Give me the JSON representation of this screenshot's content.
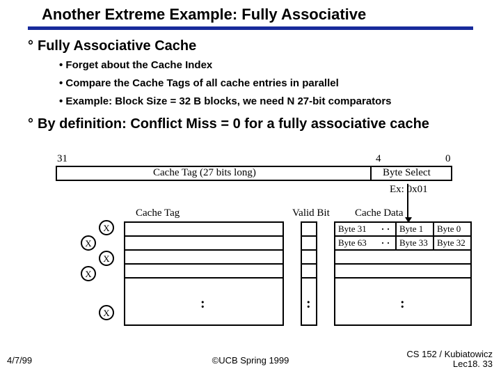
{
  "title": "Another Extreme Example: Fully Associative",
  "bullets": {
    "b1": "Fully Associative Cache",
    "s1": "Forget about the Cache Index",
    "s2": "Compare the Cache Tags of  all cache entries in parallel",
    "s3": "Example: Block Size = 32 B blocks, we need N 27-bit comparators",
    "b2": "By definition: Conflict Miss = 0 for a fully associative cache"
  },
  "addr": {
    "hi": "31",
    "mid": "4",
    "lo": "0",
    "tag_field": "Cache Tag (27 bits long)",
    "byte_select": "Byte Select",
    "example": "Ex: 0x01"
  },
  "headers": {
    "cache_tag": "Cache Tag",
    "valid_bit": "Valid Bit",
    "cache_data": "Cache Data"
  },
  "cmp_label": "X",
  "cells": {
    "r0c0": "Byte 31",
    "r0c1": "Byte 1",
    "r0c2": "Byte 0",
    "r1c0": "Byte 63",
    "r1c1": "Byte 33",
    "r1c2": "Byte 32"
  },
  "vdots": ":",
  "footer": {
    "date": "4/7/99",
    "center": "©UCB Spring 1999",
    "right1": "CS 152 / Kubiatowicz",
    "right2": "Lec18. 33"
  }
}
